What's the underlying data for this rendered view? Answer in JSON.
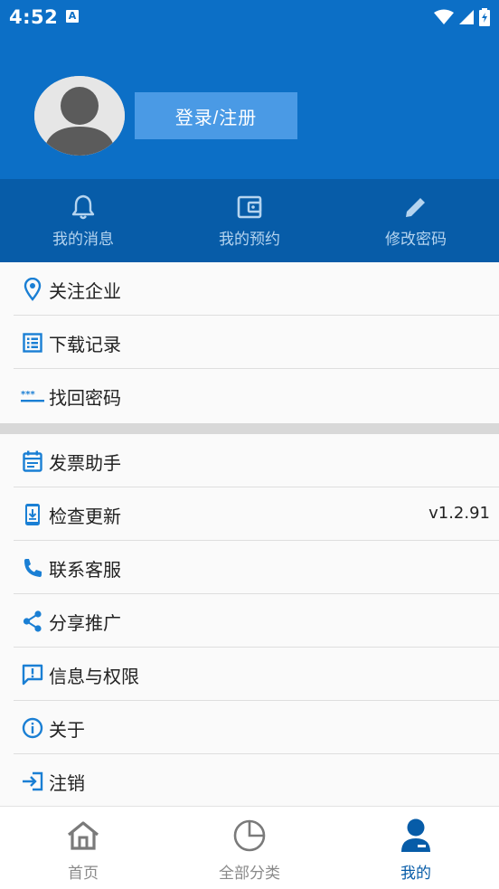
{
  "status_bar": {
    "time": "4:52",
    "notification_badge": "A"
  },
  "profile": {
    "login_label": "登录/注册"
  },
  "quick_actions": [
    {
      "label": "我的消息",
      "icon": "bell-icon"
    },
    {
      "label": "我的预约",
      "icon": "wallet-icon"
    },
    {
      "label": "修改密码",
      "icon": "pencil-icon"
    }
  ],
  "menu_group_1": [
    {
      "label": "关注企业",
      "icon": "location-pin-icon"
    },
    {
      "label": "下载记录",
      "icon": "list-icon"
    },
    {
      "label": "找回密码",
      "icon": "password-icon"
    }
  ],
  "menu_group_2": [
    {
      "label": "发票助手",
      "icon": "calendar-icon"
    },
    {
      "label": "检查更新",
      "icon": "phone-download-icon",
      "value": "v1.2.91"
    },
    {
      "label": "联系客服",
      "icon": "phone-icon"
    },
    {
      "label": "分享推广",
      "icon": "share-icon"
    },
    {
      "label": "信息与权限",
      "icon": "feedback-icon"
    },
    {
      "label": "关于",
      "icon": "info-icon"
    },
    {
      "label": "注销",
      "icon": "logout-icon"
    }
  ],
  "bottom_nav": [
    {
      "label": "首页",
      "icon": "home-icon"
    },
    {
      "label": "全部分类",
      "icon": "pie-chart-icon"
    },
    {
      "label": "我的",
      "icon": "user-icon",
      "active": true
    }
  ],
  "colors": {
    "primary": "#0c6fc6",
    "dark_primary": "#075ca8",
    "icon_blue": "#1a7fd4",
    "login_button": "#4a9ae5"
  }
}
